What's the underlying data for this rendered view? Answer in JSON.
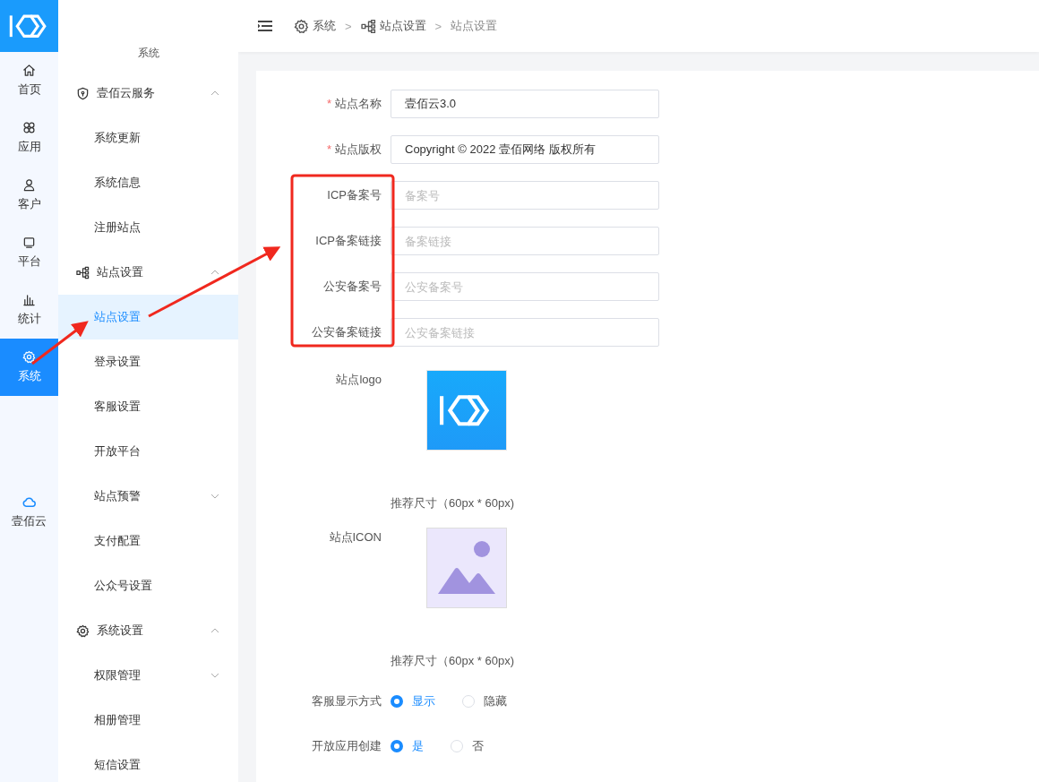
{
  "rail": {
    "items": [
      {
        "label": "首页",
        "selected": false
      },
      {
        "label": "应用",
        "selected": false
      },
      {
        "label": "客户",
        "selected": false
      },
      {
        "label": "平台",
        "selected": false
      },
      {
        "label": "统计",
        "selected": false
      },
      {
        "label": "系统",
        "selected": true
      }
    ],
    "bottom": {
      "label": "壹佰云"
    }
  },
  "menu": {
    "title": "系统",
    "groups": [
      {
        "label": "壹佰云服务",
        "expanded": true,
        "children": [
          {
            "label": "系统更新",
            "kind": "link",
            "selected": false
          },
          {
            "label": "系统信息",
            "kind": "link",
            "selected": false
          },
          {
            "label": "注册站点",
            "kind": "link",
            "selected": false
          }
        ]
      },
      {
        "label": "站点设置",
        "expanded": true,
        "children": [
          {
            "label": "站点设置",
            "kind": "link",
            "selected": true
          },
          {
            "label": "登录设置",
            "kind": "link",
            "selected": false
          },
          {
            "label": "客服设置",
            "kind": "link",
            "selected": false
          },
          {
            "label": "开放平台",
            "kind": "link",
            "selected": false
          },
          {
            "label": "站点预警",
            "kind": "submenu",
            "selected": false,
            "expanded": false
          },
          {
            "label": "支付配置",
            "kind": "link",
            "selected": false
          },
          {
            "label": "公众号设置",
            "kind": "link",
            "selected": false
          }
        ]
      },
      {
        "label": "系统设置",
        "expanded": true,
        "children": [
          {
            "label": "权限管理",
            "kind": "submenu",
            "selected": false,
            "expanded": false
          },
          {
            "label": "相册管理",
            "kind": "link",
            "selected": false
          },
          {
            "label": "短信设置",
            "kind": "link",
            "selected": false
          }
        ]
      }
    ]
  },
  "breadcrumb": {
    "separator": ">",
    "items": [
      {
        "label": "系统"
      },
      {
        "label": "站点设置"
      },
      {
        "label": "站点设置"
      }
    ]
  },
  "form": {
    "required_mark": "*",
    "fields": [
      {
        "kind": "text",
        "label": "站点名称",
        "required": true,
        "value": "壹佰云3.0"
      },
      {
        "kind": "text",
        "label": "站点版权",
        "required": true,
        "value": "Copyright © 2022 壹佰网络 版权所有"
      },
      {
        "kind": "text",
        "label": "ICP备案号",
        "required": false,
        "placeholder": "备案号"
      },
      {
        "kind": "text",
        "label": "ICP备案链接",
        "required": false,
        "placeholder": "备案链接"
      },
      {
        "kind": "text",
        "label": "公安备案号",
        "required": false,
        "placeholder": "公安备案号"
      },
      {
        "kind": "text",
        "label": "公安备案链接",
        "required": false,
        "placeholder": "公安备案链接"
      },
      {
        "kind": "logo_upload",
        "label": "站点logo",
        "hint": "推荐尺寸（60px * 60px)"
      },
      {
        "kind": "image_upload",
        "label": "站点ICON",
        "hint": "推荐尺寸（60px * 60px)"
      },
      {
        "kind": "radio",
        "label": "客服显示方式",
        "options": [
          {
            "label": "显示",
            "selected": true
          },
          {
            "label": "隐藏",
            "selected": false
          }
        ]
      },
      {
        "kind": "radio",
        "label": "开放应用创建",
        "options": [
          {
            "label": "是",
            "selected": true
          },
          {
            "label": "否",
            "selected": false
          }
        ]
      }
    ]
  }
}
